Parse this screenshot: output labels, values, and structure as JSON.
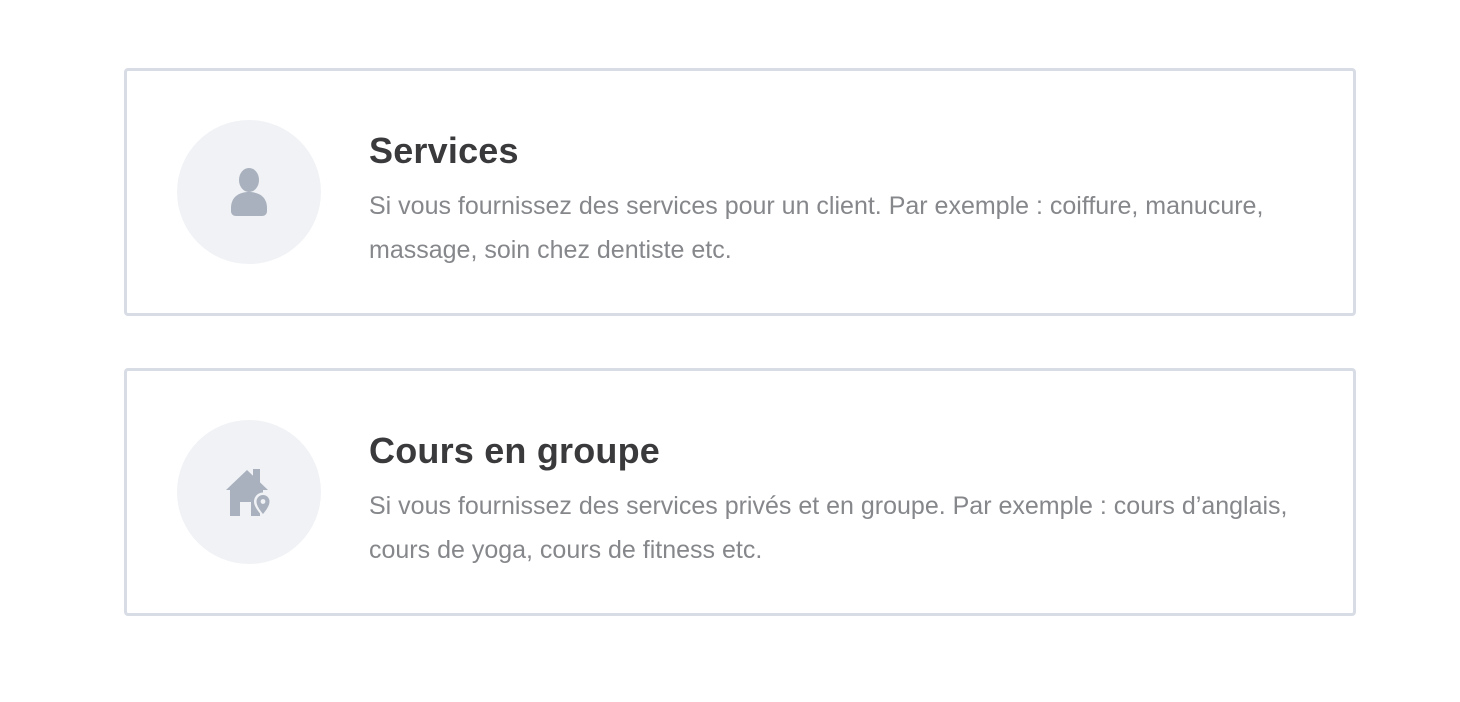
{
  "options": [
    {
      "icon": "person-icon",
      "title": "Services",
      "description": "Si vous fournissez des services pour un client. Par exemple : coiffure, manucure, massage, soin chez dentiste etc."
    },
    {
      "icon": "house-location-icon",
      "title": "Cours en groupe",
      "description": "Si vous fournissez des services privés et en groupe. Par exemple : cours d’anglais, cours de yoga, cours de fitness etc."
    }
  ],
  "colors": {
    "card_border": "#d8dde5",
    "icon_background": "#f0f2f5",
    "icon_fill": "#a8b1bd",
    "title": "#3a3a3c",
    "description": "#85878b"
  }
}
